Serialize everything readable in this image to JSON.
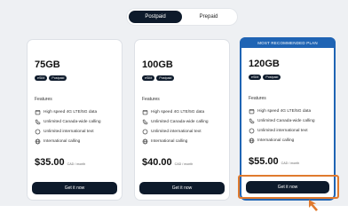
{
  "toggle": {
    "options": [
      "Postpaid",
      "Prepaid"
    ],
    "selected": "Postpaid"
  },
  "features_label": "Features",
  "badges": [
    "eSIM",
    "Postpaid"
  ],
  "plans": [
    {
      "title": "75GB",
      "features": [
        "High speed 4G LTE/5G data",
        "Unlimited Canada-wide calling",
        "Unlimited international text",
        "International calling"
      ],
      "price": "$35.00",
      "price_unit": "CAD / month",
      "cta": "Get it now"
    },
    {
      "title": "100GB",
      "features": [
        "High speed 4G LTE/5G data",
        "Unlimited Canada-wide calling",
        "Unlimited international text",
        "International calling"
      ],
      "price": "$40.00",
      "price_unit": "CAD / month",
      "cta": "Get it now"
    },
    {
      "ribbon": "MOST RECOMMENDED PLAN",
      "title": "120GB",
      "features": [
        "High speed 4G LTE/5G data",
        "Unlimited Canada-wide calling",
        "Unlimited international text",
        "International calling"
      ],
      "price": "$55.00",
      "price_unit": "CAD / month",
      "cta": "Get it now"
    }
  ],
  "feature_icons": [
    "calendar-icon",
    "phone-icon",
    "clock-icon",
    "globe-icon"
  ],
  "colors": {
    "dark": "#0d1a2b",
    "accent": "#1f64b4",
    "highlight": "#e07a2e"
  }
}
